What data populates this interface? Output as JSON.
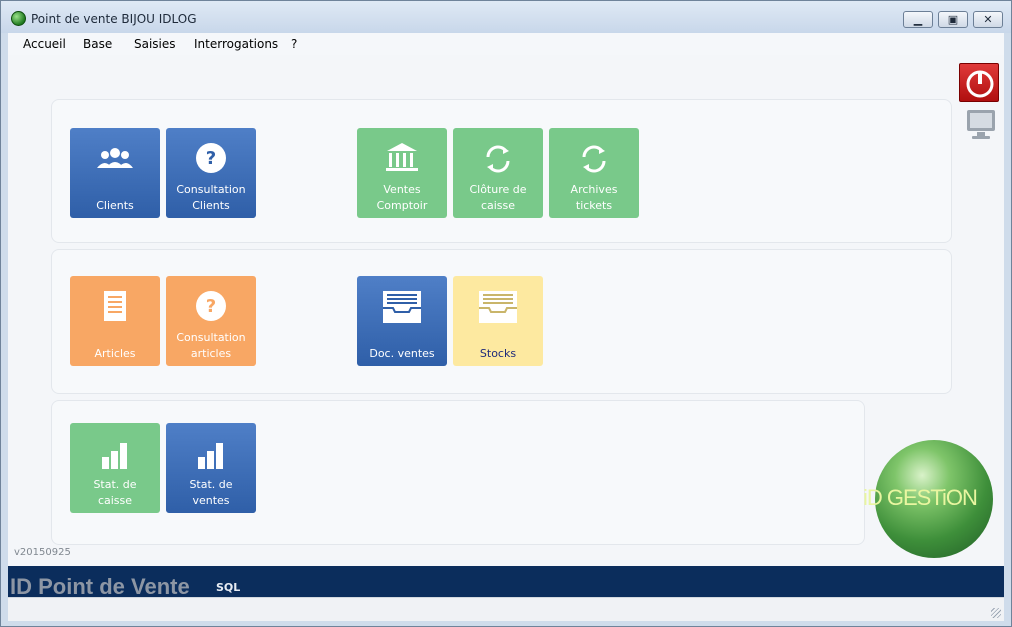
{
  "window": {
    "title": "Point de vente BIJOU IDLOG",
    "min_glyph": "▁",
    "max_glyph": "▣",
    "close_glyph": "✕"
  },
  "menu": [
    "Accueil",
    "Base",
    "Saisies",
    "Interrogations",
    "?"
  ],
  "tiles": {
    "clients": {
      "line1": "Clients",
      "line2": "",
      "icon": "users-icon"
    },
    "consult_clients": {
      "line1": "Consultation",
      "line2": "Clients",
      "icon": "question-icon"
    },
    "ventes_comptoir": {
      "line1": "Ventes",
      "line2": "Comptoir",
      "icon": "bank-icon"
    },
    "cloture_caisse": {
      "line1": "Clôture de",
      "line2": "caisse",
      "icon": "refresh-icon"
    },
    "archives_tickets": {
      "line1": "Archives",
      "line2": "tickets",
      "icon": "refresh-icon"
    },
    "articles": {
      "line1": "Articles",
      "line2": "",
      "icon": "document-icon"
    },
    "consult_articles": {
      "line1": "Consultation",
      "line2": "articles",
      "icon": "question-icon"
    },
    "doc_ventes": {
      "line1": "Doc. ventes",
      "line2": "",
      "icon": "inbox-tray-icon"
    },
    "stocks": {
      "line1": "Stocks",
      "line2": "",
      "icon": "inbox-tray-icon"
    },
    "stat_caisse": {
      "line1": "Stat. de",
      "line2": "caisse",
      "icon": "bar-chart-icon"
    },
    "stat_ventes": {
      "line1": "Stat. de",
      "line2": "ventes",
      "icon": "bar-chart-icon"
    }
  },
  "version": "v20150925",
  "logo": {
    "text": "iD GESTiON"
  },
  "footer": {
    "title": "ID Point de Vente",
    "sql": "SQL"
  },
  "colors": {
    "blue": "#3b6bb5",
    "green": "#79c98a",
    "orange": "#f8a764",
    "yellow": "#fde9a0",
    "footer": "#0b2d5c"
  }
}
